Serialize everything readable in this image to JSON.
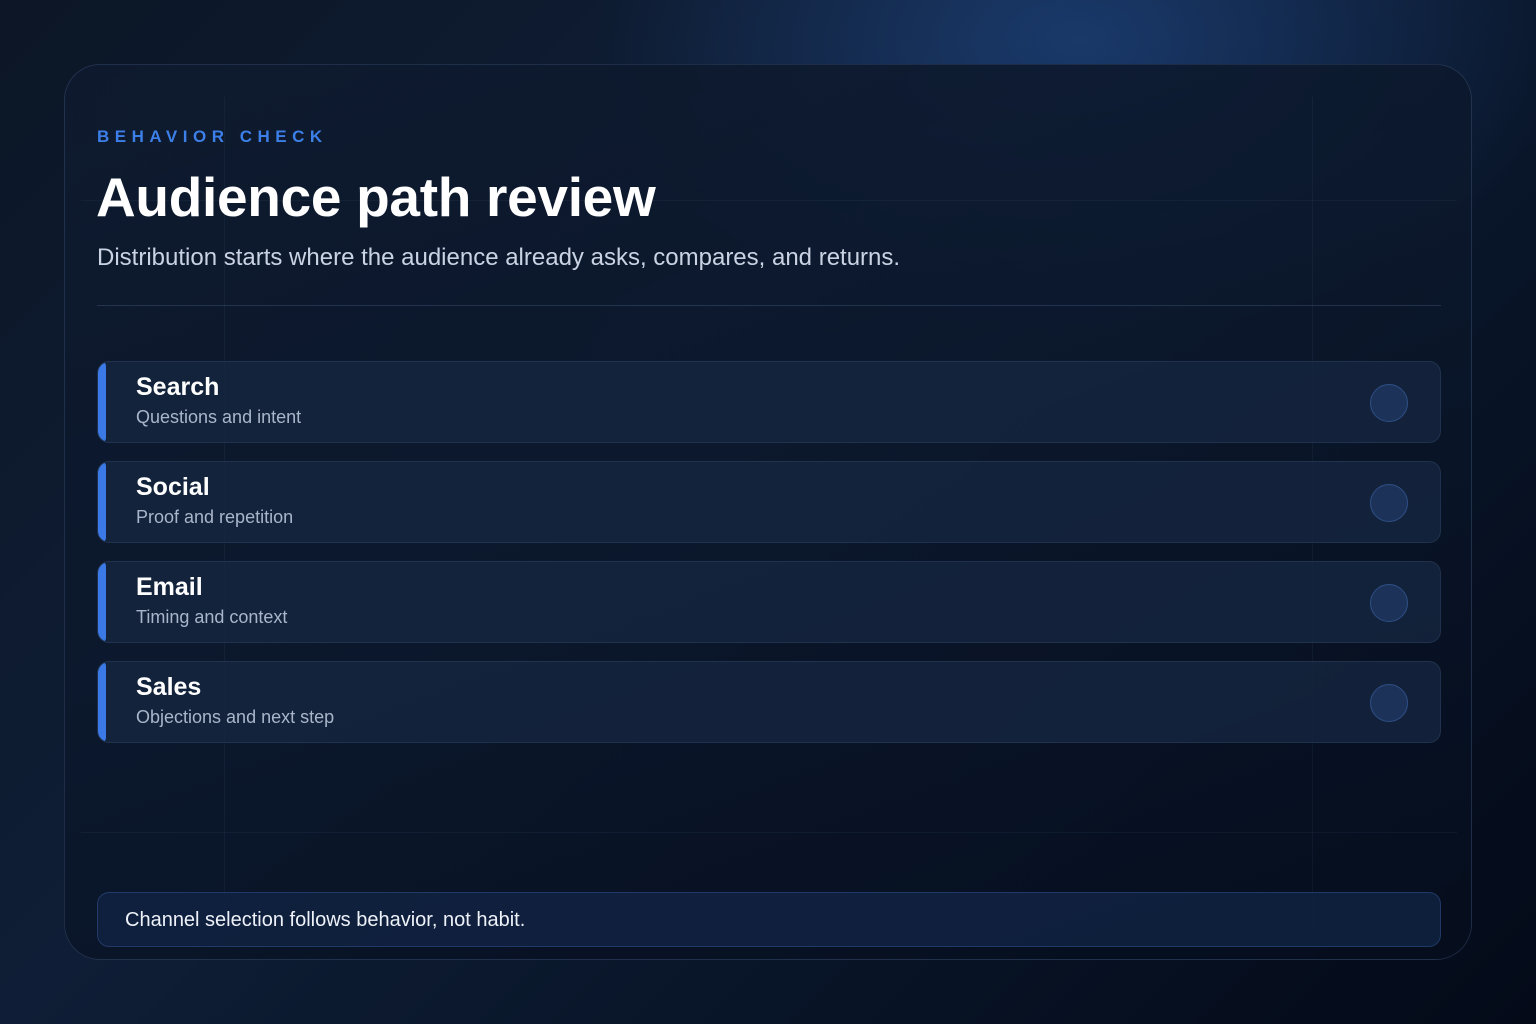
{
  "header": {
    "eyebrow": "BEHAVIOR CHECK",
    "title": "Audience path review",
    "subtitle": "Distribution starts where the audience already asks, compares, and returns."
  },
  "channels": [
    {
      "name": "Search",
      "description": "Questions and intent",
      "selected": false
    },
    {
      "name": "Social",
      "description": "Proof and repetition",
      "selected": false
    },
    {
      "name": "Email",
      "description": "Timing and context",
      "selected": false
    },
    {
      "name": "Sales",
      "description": "Objections and next step",
      "selected": false
    }
  ],
  "footer": {
    "note": "Channel selection follows behavior, not habit."
  },
  "colors": {
    "accent": "#3b7ae6",
    "eyebrow": "#3d7fe8",
    "background": "#0c1626",
    "card": "#0e1a2e",
    "toggle_fill": "#1d3258"
  }
}
